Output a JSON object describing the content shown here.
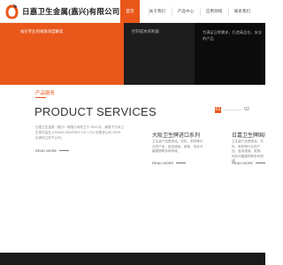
{
  "header": {
    "company_name": "日嘉卫生金属(嘉兴)有限公司",
    "nav": [
      {
        "label": "首页",
        "active": true
      },
      {
        "label": "关于我们",
        "active": false
      },
      {
        "label": "产品中心",
        "active": false
      },
      {
        "label": "应用领域",
        "active": false
      },
      {
        "label": "联系我们",
        "active": false
      }
    ]
  },
  "banner": {
    "orange_text": "站在专业的视角深度解读",
    "dark_text": "控制成本的利器",
    "desc": "为满足日常需求，打造高品位，安全的产品"
  },
  "products": {
    "label": "产品服务",
    "title": "PRODUCT SERVICES",
    "description": "日嘉卫生金属（嘉兴）有限公司成立于 2004 年，隶属于日本卫生株式会社 (OSAKA SANITARY CO.,LTD) 也是该公司 100% 出资设立的子公司。",
    "read_more": "READ MORE",
    "pager": [
      "01",
      "02"
    ],
    "cards": [
      {
        "title": "大阪卫生牌进口系列",
        "desc": "卫生级产品是食品、饮料、制药等行业的产品，医用灌装、家族、纯化冷藏建物等多种领域，",
        "read_more": "READ MORE"
      },
      {
        "title": "日嘉卫生牌国产系列",
        "desc": "卫生级产品是食品、饮料、制药等行业的产品，医用灌装、家族、纯化冷藏建物等多种领域，",
        "read_more": "READ MORE"
      }
    ]
  },
  "colors": {
    "accent": "#e9571a",
    "dark": "#0f0f0f"
  },
  "icons": {
    "logo": "company-logo-icon"
  }
}
